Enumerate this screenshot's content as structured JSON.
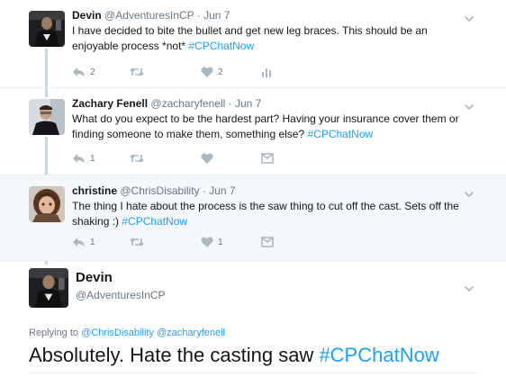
{
  "tweets": [
    {
      "name": "Devin",
      "handle": "@AdventuresInCP",
      "sep": "·",
      "time": "Jun 7",
      "text": "I have decided to bite the bullet and get new leg braces. This should be an enjoyable process *not* ",
      "hashtag": "#CPChatNow",
      "reply_count": "2",
      "retweet_count": "",
      "like_count": "2"
    },
    {
      "name": "Zachary Fenell",
      "handle": "@zacharyfenell",
      "sep": "·",
      "time": "Jun 7",
      "text": "What do you expect to be the hardest part? Having your insurance cover them or finding someone to make them, something else? ",
      "hashtag": "#CPChatNow",
      "reply_count": "1",
      "retweet_count": "",
      "like_count": ""
    },
    {
      "name": "christine",
      "handle": "@ChrisDisability",
      "sep": "·",
      "time": "Jun 7",
      "text": "The thing I hate about the process is the saw thing to cut off the cast. Sets off the shaking :) ",
      "hashtag": "#CPChatNow",
      "reply_count": "1",
      "retweet_count": "",
      "like_count": "1"
    }
  ],
  "focus": {
    "name": "Devin",
    "handle": "@AdventuresInCP",
    "replying_prefix": "Replying to ",
    "mention1": "@ChrisDisability",
    "mention2": "@zacharyfenell",
    "text": "Absolutely. Hate the casting saw ",
    "hashtag": "#CPChatNow"
  },
  "colors": {
    "link": "#1da1f2",
    "secondary_text": "#657786",
    "icon": "#aab8c2",
    "thread_line": "#ccd6dd",
    "highlight_bg": "#f5f8fa"
  },
  "icons": [
    "reply-icon",
    "retweet-icon",
    "heart-icon",
    "analytics-icon",
    "direct-message-icon",
    "chevron-down-icon"
  ]
}
